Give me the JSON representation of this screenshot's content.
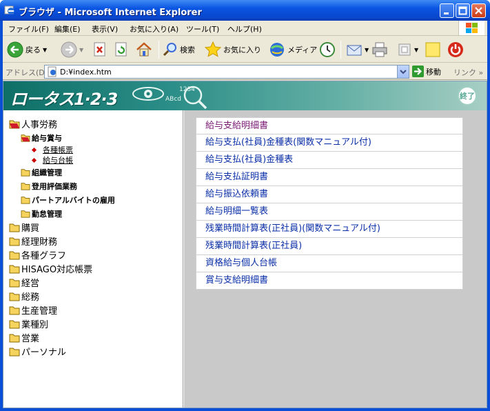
{
  "window": {
    "title": "ブラウザ - Microsoft Internet Explorer"
  },
  "menu": {
    "items": [
      "ファイル(F)",
      "編集(E)",
      "表示(V)",
      "お気に入り(A)",
      "ツール(T)",
      "ヘルプ(H)"
    ]
  },
  "toolbar": {
    "back": "戻る",
    "search": "検索",
    "favorites": "お気に入り",
    "media": "メディア"
  },
  "address": {
    "label": "アドレス(D)",
    "value": "D:¥index.htm",
    "go": "移動",
    "links": "リンク"
  },
  "banner": {
    "title": "ロータス1·2·3",
    "end_label": "終了"
  },
  "tree": {
    "jinji": "人事労務",
    "kyuyo": "給与賞与",
    "kakushu_chohyo": "各種帳票",
    "kyuyo_daicho": "給与台帳",
    "soshiki": "組織管理",
    "toyo": "登用評価業務",
    "part": "パートアルバイトの雇用",
    "kintai": "勤怠管理",
    "konyu": "購買",
    "keiri": "経理財務",
    "graph": "各種グラフ",
    "hisago": "HISAGO対応帳票",
    "keiei": "経営",
    "somu": "総務",
    "seisan": "生産管理",
    "gyoshu": "業種別",
    "eigyo": "営業",
    "personal": "パーソナル"
  },
  "reports": [
    "給与支給明細書",
    "給与支払(社員)金種表(関数マニュアル付)",
    "給与支払(社員)金種表",
    "給与支払証明書",
    "給与振込依頼書",
    "給与明細一覧表",
    "残業時間計算表(正社員)(関数マニュアル付)",
    "残業時間計算表(正社員)",
    "資格給与個人台帳",
    "賞与支給明細書"
  ],
  "colors": {
    "titlebar": "#0a55e2",
    "banner": "#2c8e88",
    "link": "#0a2fa8",
    "visited": "#7a1a74",
    "folder": "#f5d35c"
  }
}
